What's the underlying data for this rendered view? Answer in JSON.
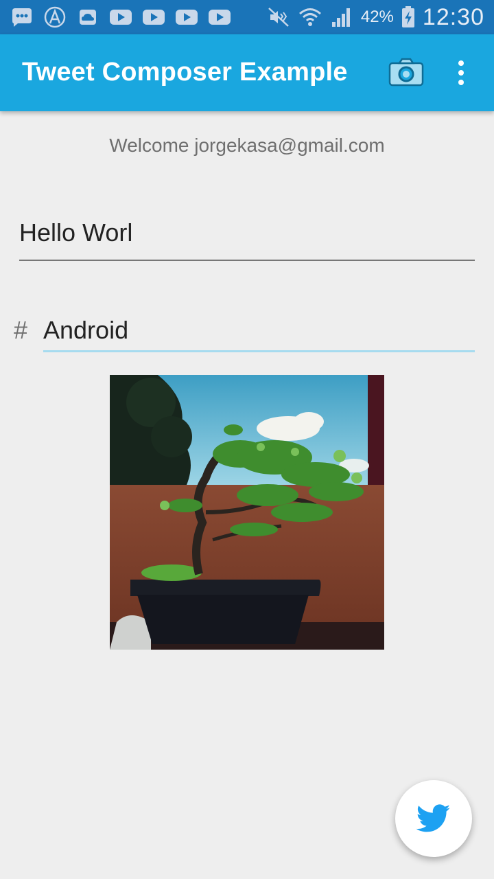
{
  "status_bar": {
    "left_icons": [
      "chat-icon",
      "app-icon",
      "cloud-icon",
      "youtube-icon",
      "youtube-icon",
      "youtube-icon",
      "youtube-icon"
    ],
    "right_icons": [
      "mute-icon",
      "wifi-icon",
      "signal-icon",
      "battery-charging-icon"
    ],
    "battery": "42%",
    "time": "12:30"
  },
  "app_bar": {
    "title": "Tweet Composer Example",
    "actions": [
      "camera-icon",
      "overflow-menu-icon"
    ],
    "color": "#1aa7df"
  },
  "content": {
    "welcome": "Welcome jorgekasa@gmail.com",
    "tweet_text": "Hello Worl",
    "hashtag_symbol": "#",
    "hashtag_text": "Android",
    "image": "bonsai-photo"
  },
  "fab": {
    "icon": "twitter-bird-icon",
    "color": "#1da1f2"
  }
}
